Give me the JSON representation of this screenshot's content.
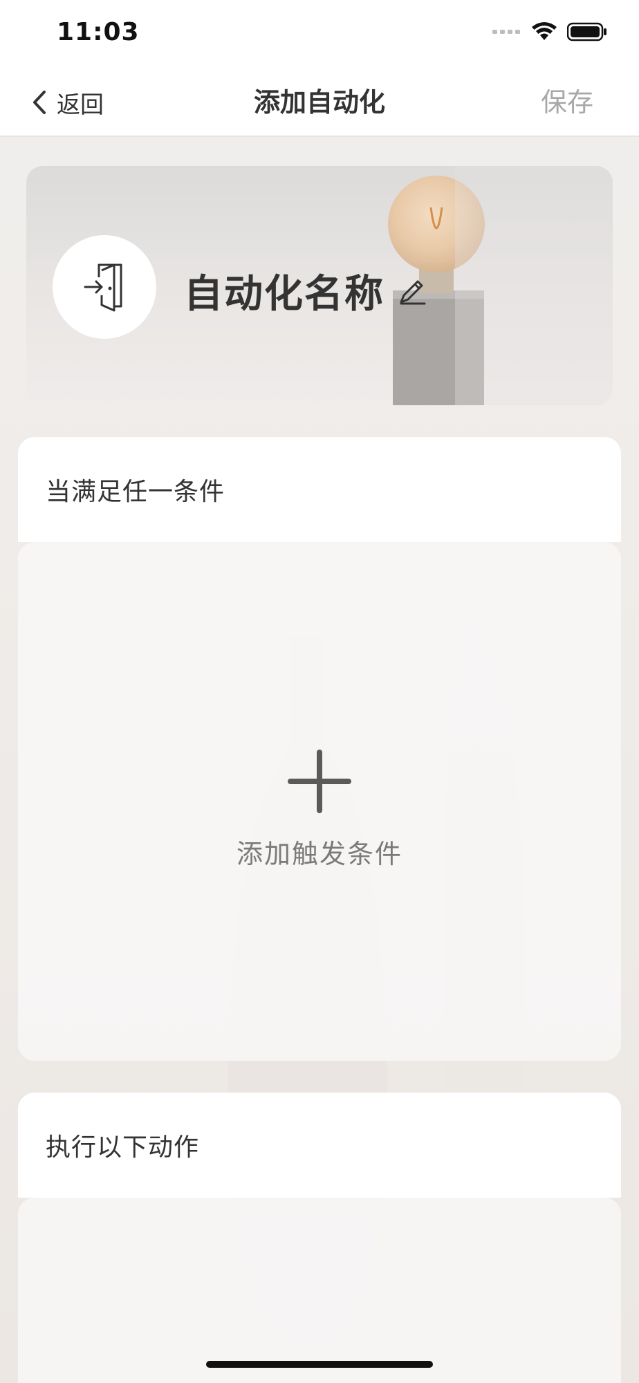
{
  "status_bar": {
    "time": "11:03",
    "icons": [
      "cellular-signal-icon",
      "wifi-icon",
      "battery-icon"
    ]
  },
  "nav": {
    "back_label": "返回",
    "title": "添加自动化",
    "save_label": "保存"
  },
  "banner": {
    "icon": "door-enter-icon",
    "name": "自动化名称",
    "edit_icon": "pencil-icon"
  },
  "conditions": {
    "header": "当满足任一条件",
    "add_label": "添加触发条件",
    "add_icon": "plus-icon"
  },
  "actions": {
    "header": "执行以下动作"
  },
  "colors": {
    "accent_text": "#333333",
    "disabled_text": "#a8a8a8",
    "background": "#f2f0ee"
  }
}
